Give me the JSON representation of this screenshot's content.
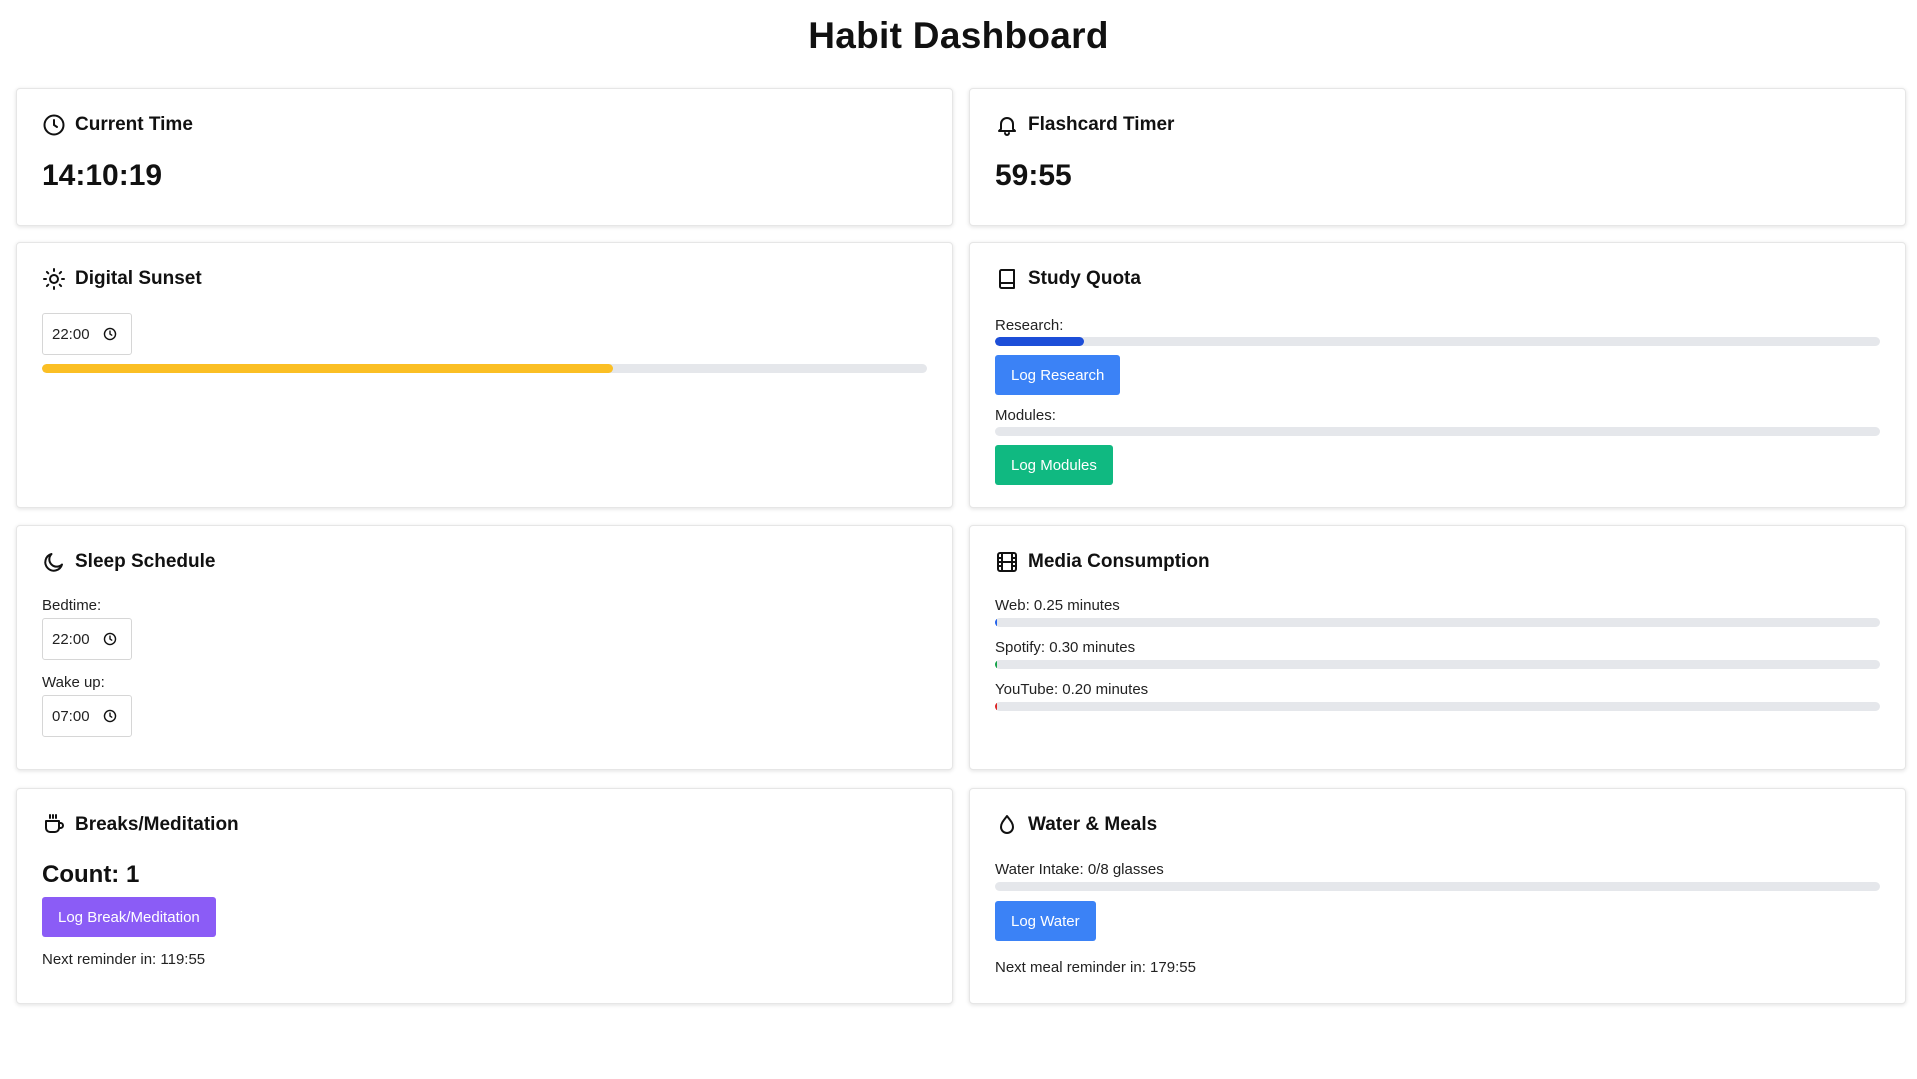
{
  "title": "Habit Dashboard",
  "current_time": {
    "title": "Current Time",
    "icon": "clock-icon",
    "value": "14:10:19"
  },
  "flashcard_timer": {
    "title": "Flashcard Timer",
    "icon": "bell-icon",
    "value": "59:55"
  },
  "digital_sunset": {
    "title": "Digital Sunset",
    "icon": "sun-icon",
    "time_value": "22:00",
    "progress_fraction": 0.645,
    "progress_color": "#fbbf24"
  },
  "study_quota": {
    "title": "Study Quota",
    "icon": "book-icon",
    "research_label": "Research:",
    "research_fraction": 0.1,
    "research_color": "#1d4ed8",
    "research_button": "Log Research",
    "research_button_color": "#3b82f6",
    "modules_label": "Modules:",
    "modules_fraction": 0,
    "modules_button": "Log Modules",
    "modules_button_color": "#10b981"
  },
  "sleep_schedule": {
    "title": "Sleep Schedule",
    "icon": "moon-icon",
    "bedtime_label": "Bedtime:",
    "bedtime_value": "22:00",
    "wakeup_label": "Wake up:",
    "wakeup_value": "07:00"
  },
  "media_consumption": {
    "title": "Media Consumption",
    "icon": "film-icon",
    "items": [
      {
        "label": "Web: 0.25 minutes",
        "fraction": 0.002,
        "color": "#2563eb"
      },
      {
        "label": "Spotify: 0.30 minutes",
        "fraction": 0.002,
        "color": "#16a34a"
      },
      {
        "label": "YouTube: 0.20 minutes",
        "fraction": 0.002,
        "color": "#dc2626"
      }
    ]
  },
  "breaks": {
    "title": "Breaks/Meditation",
    "icon": "coffee-icon",
    "count": "Count: 1",
    "button": "Log Break/Meditation",
    "button_color": "#8b5cf6",
    "reminder": "Next reminder in: 119:55"
  },
  "water_meals": {
    "title": "Water & Meals",
    "icon": "droplet-icon",
    "intake_label": "Water Intake: 0/8 glasses",
    "intake_fraction": 0,
    "button": "Log Water",
    "button_color": "#3b82f6",
    "reminder": "Next meal reminder in: 179:55"
  }
}
